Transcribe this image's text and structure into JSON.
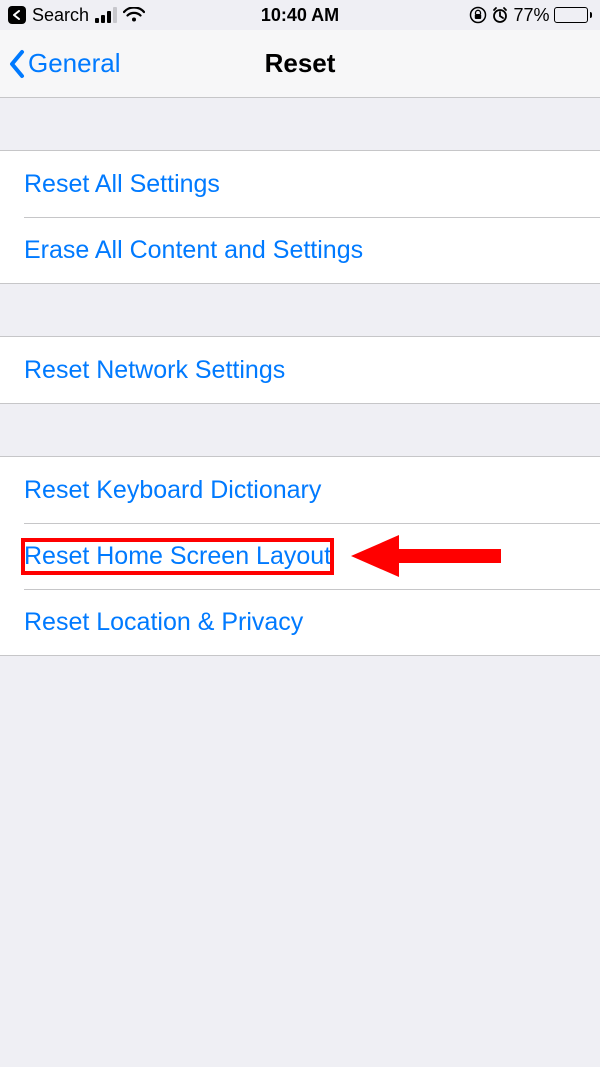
{
  "status_bar": {
    "back_app": "Search",
    "time": "10:40 AM",
    "battery_percent": "77%"
  },
  "nav": {
    "back_label": "General",
    "title": "Reset"
  },
  "groups": [
    {
      "rows": [
        {
          "label": "Reset All Settings"
        },
        {
          "label": "Erase All Content and Settings"
        }
      ]
    },
    {
      "rows": [
        {
          "label": "Reset Network Settings"
        }
      ]
    },
    {
      "rows": [
        {
          "label": "Reset Keyboard Dictionary"
        },
        {
          "label": "Reset Home Screen Layout",
          "highlighted": true
        },
        {
          "label": "Reset Location & Privacy"
        }
      ]
    }
  ],
  "annotation": {
    "highlight_color": "#ff0000"
  }
}
